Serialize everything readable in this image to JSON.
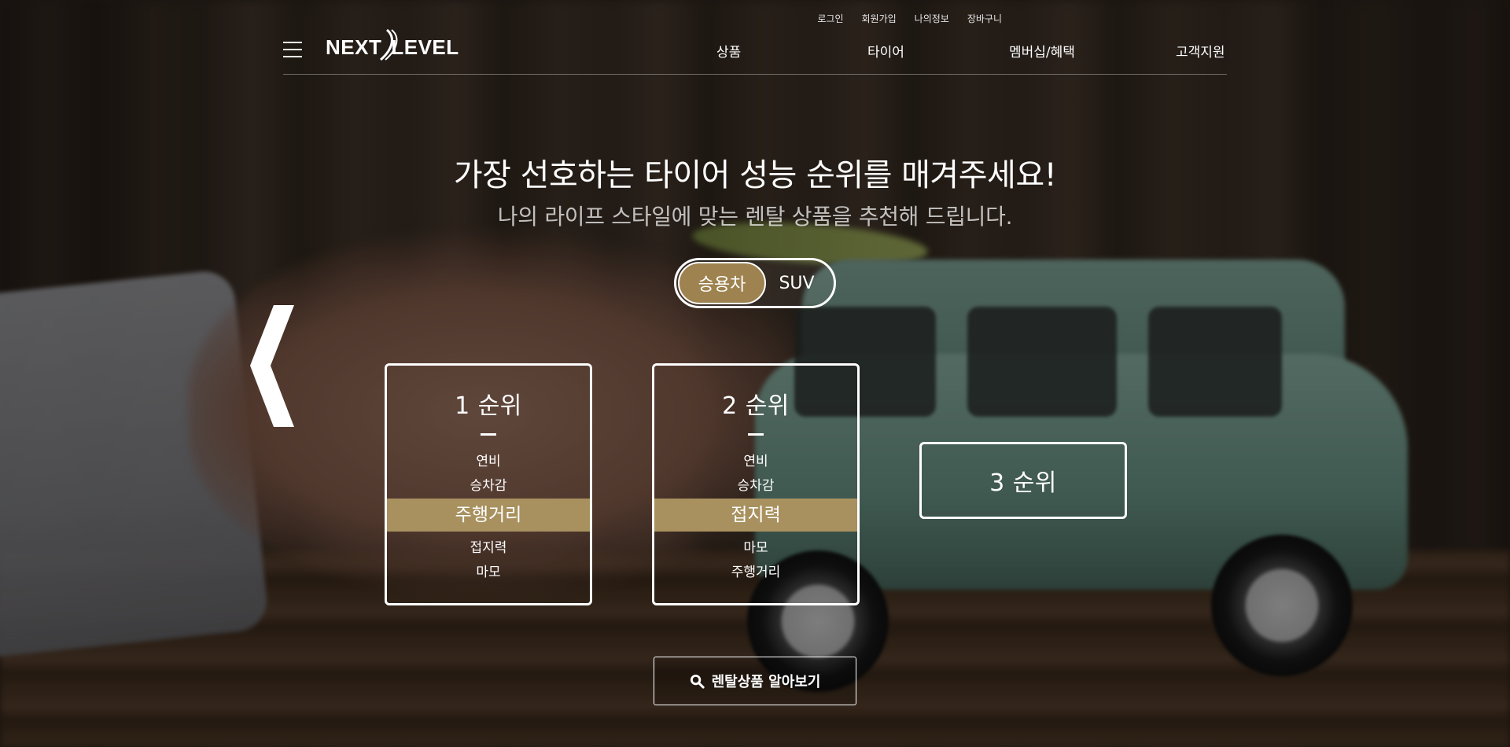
{
  "util_links": [
    "로그인",
    "회원가입",
    "나의정보",
    "장바구니"
  ],
  "logo": {
    "word1": "NEXT",
    "word2": "LEVEL"
  },
  "gnb": [
    "상품",
    "타이어",
    "멤버십/혜택",
    "고객지원"
  ],
  "hero": {
    "title": "가장 선호하는 타이어 성능 순위를 매겨주세요!",
    "subtitle": "나의 라이프 스타일에 맞는 렌탈 상품을 추천해 드립니다."
  },
  "vehicle_toggle": {
    "options": [
      "승용차",
      "SUV"
    ],
    "selected": "승용차"
  },
  "rank_cards": [
    {
      "rank": "1 순위",
      "items": [
        "연비",
        "승차감",
        "주행거리",
        "접지력",
        "마모"
      ],
      "highlighted": "주행거리"
    },
    {
      "rank": "2 순위",
      "items": [
        "연비",
        "승차감",
        "접지력",
        "마모",
        "주행거리"
      ],
      "highlighted": "접지력"
    },
    {
      "rank": "3 순위"
    }
  ],
  "cta": {
    "label": "렌탈상품 알아보기",
    "icon": "search-icon"
  },
  "colors": {
    "accent_gold": "#9e8350",
    "highlight_gold": "#a8915f",
    "text": "#ffffff"
  }
}
